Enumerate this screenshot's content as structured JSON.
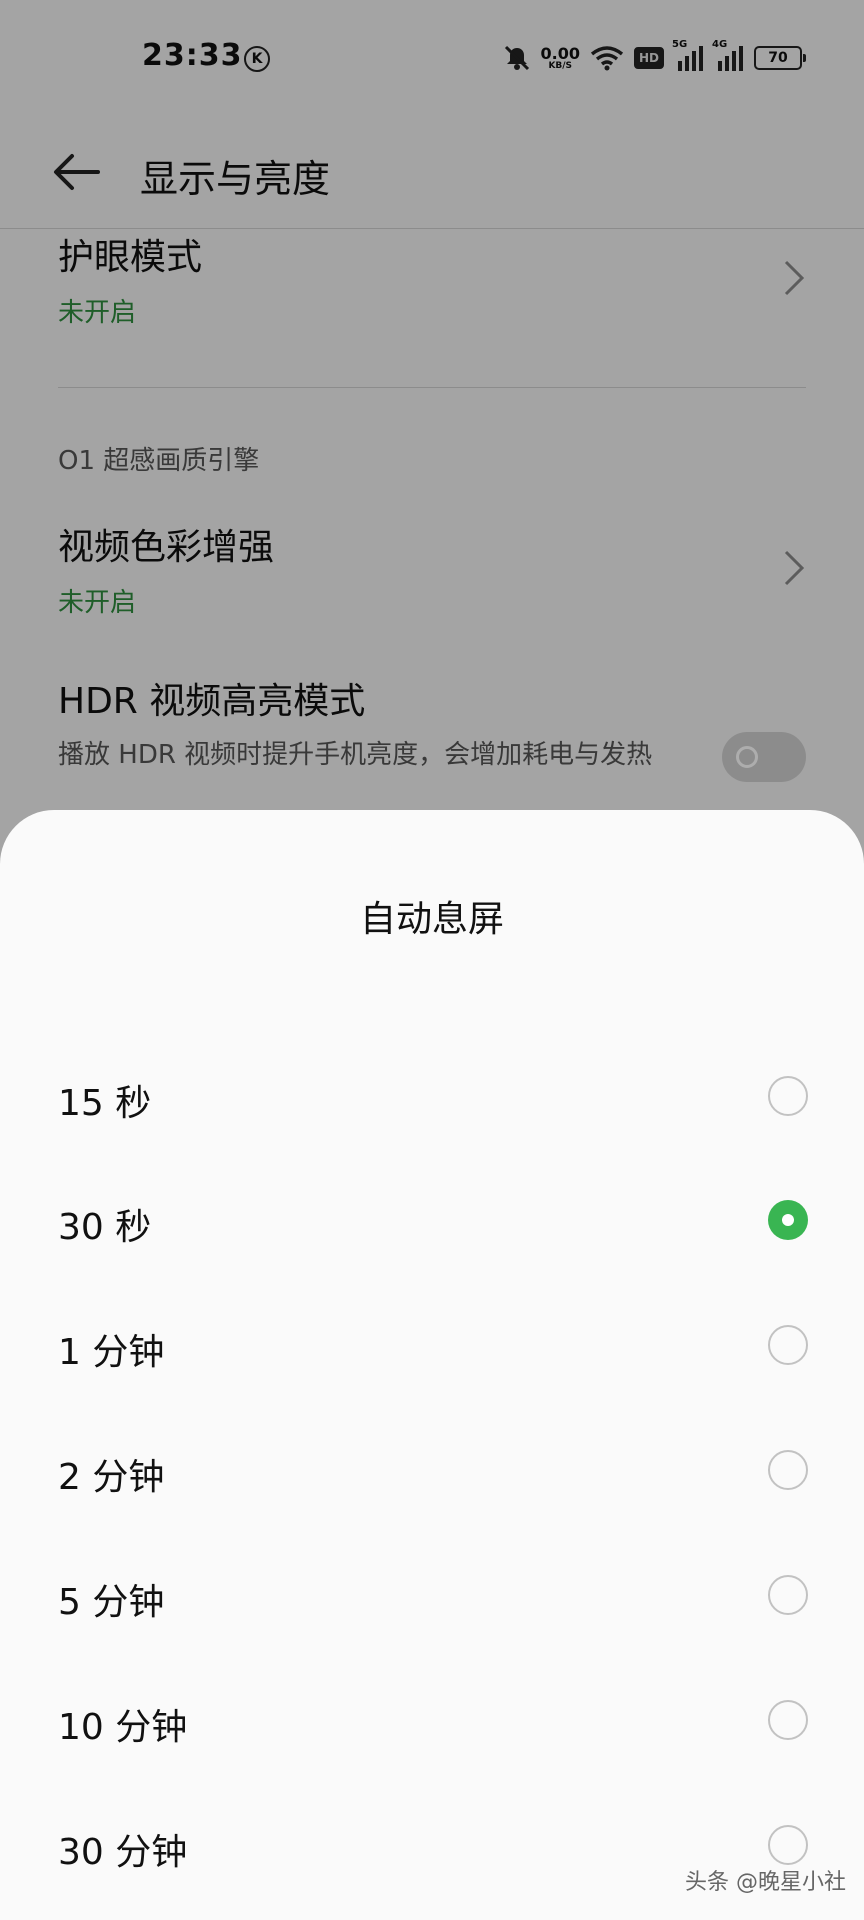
{
  "status": {
    "time": "23:33",
    "k_badge": "K",
    "net_value": "0.00",
    "net_unit": "KB/S",
    "hd": "HD",
    "sig1": "5G",
    "sig2": "4G",
    "battery": "70"
  },
  "header": {
    "title": "显示与亮度"
  },
  "settings": {
    "eye_care": {
      "title": "护眼模式",
      "status": "未开启"
    },
    "section": "O1 超感画质引擎",
    "video_color": {
      "title": "视频色彩增强",
      "status": "未开启"
    },
    "hdr": {
      "title": "HDR 视频高亮模式",
      "desc": "播放 HDR 视频时提升手机亮度，会增加耗电与发热",
      "enabled": false
    }
  },
  "sheet": {
    "title": "自动息屏",
    "options": [
      {
        "label": "15 秒",
        "selected": false
      },
      {
        "label": "30 秒",
        "selected": true
      },
      {
        "label": "1 分钟",
        "selected": false
      },
      {
        "label": "2 分钟",
        "selected": false
      },
      {
        "label": "5 分钟",
        "selected": false
      },
      {
        "label": "10 分钟",
        "selected": false
      },
      {
        "label": "30 分钟",
        "selected": false
      }
    ],
    "accent_color": "#39b552"
  },
  "watermark": "头条 @晚星小社"
}
